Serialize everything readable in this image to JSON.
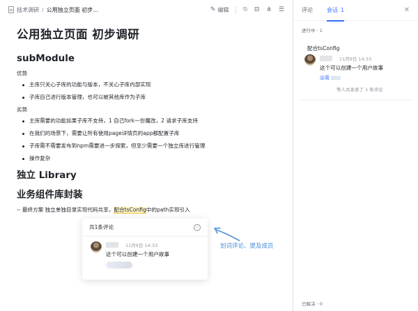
{
  "breadcrumb": {
    "root": "技术调研",
    "separator": "/",
    "current": "公用独立页面 初步..."
  },
  "toolbar": {
    "edit_label": "编辑"
  },
  "document": {
    "title": "公用独立页面 初步调研",
    "submodule": {
      "heading": "subModule",
      "pros_label": "优势",
      "pros": [
        "主库只关心子库的功能与版本，不关心子库内部实现",
        "子库自己进行版本管理，也可以被其他库作为子库"
      ],
      "cons_label": "劣势",
      "cons": [
        "主库需要的功能如果子库不支持，1 自己fork一份魔改，2 请求子库支持",
        "在我们的场景下，需要让所有使用page详情页的app都配置子库",
        "子库需不需要发布到npm需要进一步探索，但至少需要一个独立库进行管理",
        "操作复杂"
      ]
    },
    "library_heading": "独立 Library",
    "business_heading": "业务组件库封装",
    "final": {
      "prefix": "-- 最终方案  独立单独目录实现代码共享，",
      "highlight": "配合tsConfig",
      "suffix": "中的path实现引入"
    }
  },
  "comment_card": {
    "header": "共1条评论",
    "date": "11月9日 14:33",
    "text": "这个可以创建一个用户故事"
  },
  "annotation": {
    "text": "划词评论、提及成员",
    "color": "#4a90d9"
  },
  "right_panel": {
    "tabs": [
      {
        "label": "评论"
      },
      {
        "label": "会话",
        "count": "1"
      }
    ],
    "close_icon": "close-icon",
    "in_progress_label": "进行中 · 1",
    "thread": {
      "quote": "配合tsConfig",
      "date": "11月9日 14:33",
      "text": "这个可以创建一个用户故事",
      "mention_prefix": "@周",
      "reply_note": "等人共发表了 1 条评论"
    },
    "resolved_label": "已解决 · 0"
  },
  "colors": {
    "accent": "#3370ff",
    "highlight": "#fff4c7"
  }
}
